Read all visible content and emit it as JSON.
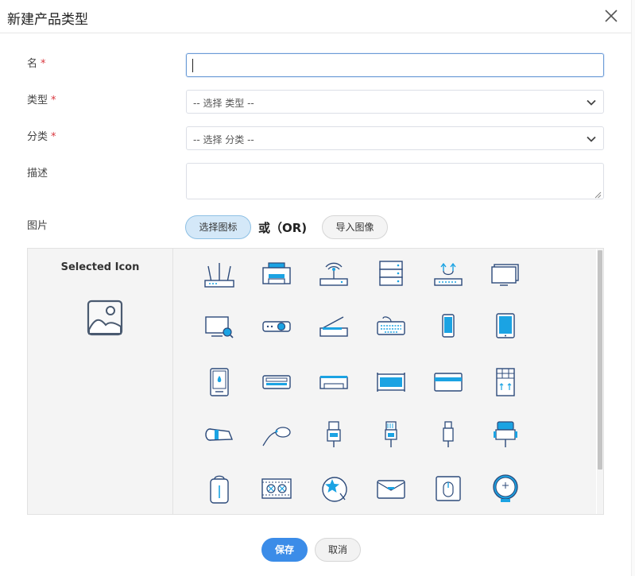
{
  "dialog": {
    "title": "新建产品类型",
    "close_icon": "close-icon"
  },
  "form": {
    "name": {
      "label": "名",
      "required_mark": "*",
      "value": ""
    },
    "type": {
      "label": "类型",
      "required_mark": "*",
      "placeholder": "-- 选择 类型 --"
    },
    "category": {
      "label": "分类",
      "required_mark": "*",
      "placeholder": "-- 选择 分类 --"
    },
    "description": {
      "label": "描述",
      "value": ""
    },
    "image": {
      "label": "图片",
      "choose_icon_button": "选择图标",
      "or_text": "或（OR)",
      "import_image_button": "导入图像"
    }
  },
  "icon_picker": {
    "selected_label": "Selected Icon",
    "placeholder_icon": "image-placeholder-icon",
    "icons": [
      "router-icon",
      "printer-icon",
      "wireless-ap-icon",
      "server-icon",
      "network-switch-icon",
      "monitor-icon",
      "monitor-search-icon",
      "projector-icon",
      "scanner-icon",
      "keyboard-icon",
      "phone-icon",
      "tablet-icon",
      "card-reader-icon",
      "tape-drive-icon",
      "receipt-printer-icon",
      "rack-unit-icon",
      "credit-card-icon",
      "panel-icon",
      "cable-roll-icon",
      "stylus-cable-icon",
      "usb-connector-icon",
      "ethernet-connector-icon",
      "usb-plug-icon",
      "vga-connector-icon",
      "backpack-icon",
      "film-reel-icon",
      "star-disc-icon",
      "envelope-icon",
      "mouse-icon",
      "round-button-icon"
    ]
  },
  "footer": {
    "save_label": "保存",
    "cancel_label": "取消"
  },
  "colors": {
    "accent": "#3b8ce8",
    "icon_blue": "#1ba3e3",
    "icon_navy": "#2c4a7a",
    "required": "#d9363e"
  }
}
